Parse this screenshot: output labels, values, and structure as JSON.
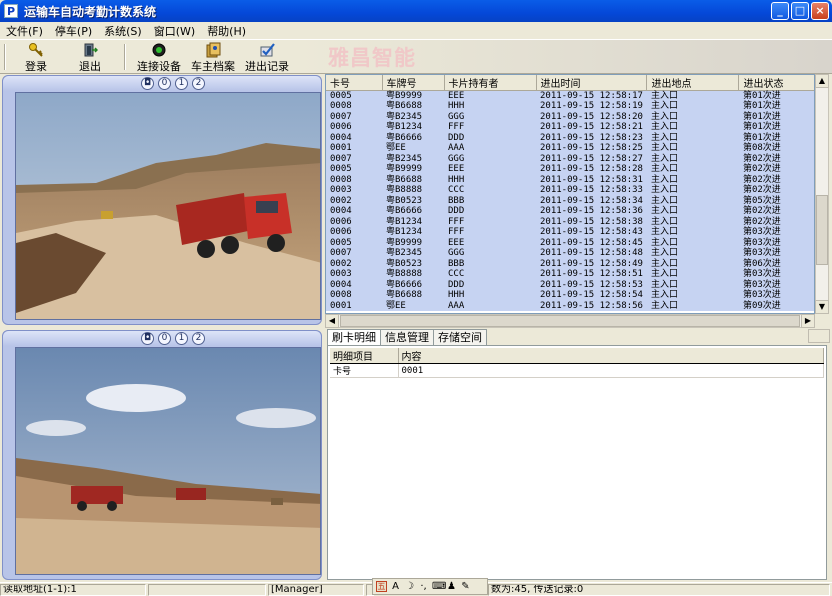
{
  "window": {
    "app_icon": "P",
    "title": "运输车自动考勤计数系统",
    "controls": {
      "minimize": "_",
      "maximize": "□",
      "close": "×"
    }
  },
  "menubar": [
    {
      "label": "文件(F)"
    },
    {
      "label": "停车(P)"
    },
    {
      "label": "系统(S)"
    },
    {
      "label": "窗口(W)"
    },
    {
      "label": "帮助(H)"
    }
  ],
  "toolbar": {
    "login": {
      "label": "登录",
      "icon": "key-icon"
    },
    "logout": {
      "label": "退出",
      "icon": "exit-door-icon"
    },
    "connect": {
      "label": "连接设备",
      "icon": "device-connect-icon"
    },
    "owners": {
      "label": "车主档案",
      "icon": "owner-files-icon"
    },
    "records": {
      "label": "进出记录",
      "icon": "record-checklist-icon"
    }
  },
  "brand": "雅昌智能",
  "video": {
    "controls": [
      "◘",
      "0",
      "1",
      "2"
    ]
  },
  "grid": {
    "columns": [
      "卡号",
      "车牌号",
      "卡片持有者",
      "进出时间",
      "进出地点",
      "进出状态"
    ],
    "rows": [
      [
        "0005",
        "粤B9999",
        "EEE",
        "2011-09-15  12:58:17",
        "主入口",
        "第01次进"
      ],
      [
        "0008",
        "粤B6688",
        "HHH",
        "2011-09-15  12:58:19",
        "主入口",
        "第01次进"
      ],
      [
        "0007",
        "粤B2345",
        "GGG",
        "2011-09-15  12:58:20",
        "主入口",
        "第01次进"
      ],
      [
        "0006",
        "粤B1234",
        "FFF",
        "2011-09-15  12:58:21",
        "主入口",
        "第01次进"
      ],
      [
        "0004",
        "粤B6666",
        "DDD",
        "2011-09-15  12:58:23",
        "主入口",
        "第01次进"
      ],
      [
        "0001",
        "鄂EE",
        "AAA",
        "2011-09-15  12:58:25",
        "主入口",
        "第08次进"
      ],
      [
        "0007",
        "粤B2345",
        "GGG",
        "2011-09-15  12:58:27",
        "主入口",
        "第02次进"
      ],
      [
        "0005",
        "粤B9999",
        "EEE",
        "2011-09-15  12:58:28",
        "主入口",
        "第02次进"
      ],
      [
        "0008",
        "粤B6688",
        "HHH",
        "2011-09-15  12:58:31",
        "主入口",
        "第02次进"
      ],
      [
        "0003",
        "粤B8888",
        "CCC",
        "2011-09-15  12:58:33",
        "主入口",
        "第02次进"
      ],
      [
        "0002",
        "粤B0523",
        "BBB",
        "2011-09-15  12:58:34",
        "主入口",
        "第05次进"
      ],
      [
        "0004",
        "粤B6666",
        "DDD",
        "2011-09-15  12:58:36",
        "主入口",
        "第02次进"
      ],
      [
        "0006",
        "粤B1234",
        "FFF",
        "2011-09-15  12:58:38",
        "主入口",
        "第02次进"
      ],
      [
        "0006",
        "粤B1234",
        "FFF",
        "2011-09-15  12:58:43",
        "主入口",
        "第03次进"
      ],
      [
        "0005",
        "粤B9999",
        "EEE",
        "2011-09-15  12:58:45",
        "主入口",
        "第03次进"
      ],
      [
        "0007",
        "粤B2345",
        "GGG",
        "2011-09-15  12:58:48",
        "主入口",
        "第03次进"
      ],
      [
        "0002",
        "粤B0523",
        "BBB",
        "2011-09-15  12:58:49",
        "主入口",
        "第06次进"
      ],
      [
        "0003",
        "粤B8888",
        "CCC",
        "2011-09-15  12:58:51",
        "主入口",
        "第03次进"
      ],
      [
        "0004",
        "粤B6666",
        "DDD",
        "2011-09-15  12:58:53",
        "主入口",
        "第03次进"
      ],
      [
        "0008",
        "粤B6688",
        "HHH",
        "2011-09-15  12:58:54",
        "主入口",
        "第03次进"
      ],
      [
        "0001",
        "鄂EE",
        "AAA",
        "2011-09-15  12:58:56",
        "主入口",
        "第09次进"
      ]
    ]
  },
  "tabs": [
    {
      "label": "刷卡明细",
      "active": true
    },
    {
      "label": "信息管理",
      "active": false
    },
    {
      "label": "存储空间",
      "active": false
    }
  ],
  "detail": {
    "columns": [
      "明细项目",
      "内容"
    ],
    "rows": [
      [
        "卡号",
        "0001"
      ]
    ]
  },
  "statusbar": {
    "read_address": "读取地址(1-1):1",
    "user": "[Manager]",
    "count_text": "数为:45, 传送记录:0",
    "mini_toolbar_icons": [
      "ime-icon",
      "font-icon",
      "moon-icon",
      "dots-icon",
      "keyboard-icon",
      "user-icon",
      "wrench-icon"
    ]
  },
  "colors": {
    "title_blue": "#0548d8",
    "grid_row_bg": "#c6d3f2",
    "video_frame": "#b8c4e8"
  }
}
